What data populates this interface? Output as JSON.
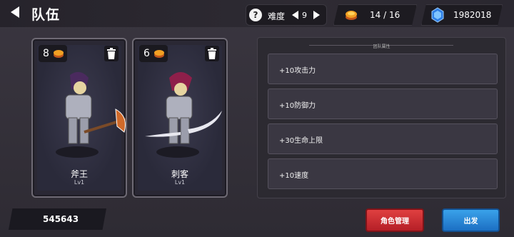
{
  "header": {
    "title": "队伍",
    "difficulty_label": "难度",
    "difficulty_value": "9",
    "coins_text": "14 / 16",
    "gems_text": "1982018"
  },
  "team": [
    {
      "cost": "8",
      "name": "斧王",
      "level": "Lv1"
    },
    {
      "cost": "6",
      "name": "刺客",
      "level": "Lv1"
    }
  ],
  "attributes": {
    "title": "团队属性",
    "items": [
      "+10攻击力",
      "+10防御力",
      "+30生命上限",
      "+10速度"
    ]
  },
  "footer": {
    "score": "545643",
    "manage_label": "角色管理",
    "start_label": "出发"
  },
  "colors": {
    "red_button": "#c92a32",
    "blue_button": "#2b86d6",
    "coin": "#f2a023",
    "gem": "#3a8cf0"
  }
}
